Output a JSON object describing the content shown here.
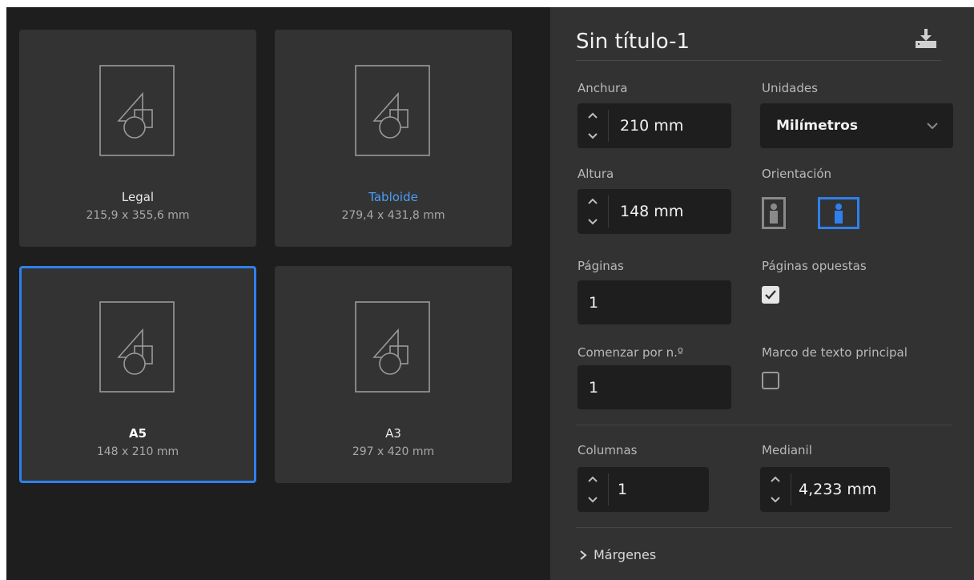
{
  "presets": [
    {
      "name": "Legal",
      "size": "215,9 x 355,6 mm",
      "selected": false,
      "highlight": false
    },
    {
      "name": "Tabloide",
      "size": "279,4 x 431,8 mm",
      "selected": false,
      "highlight": true
    },
    {
      "name": "A5",
      "size": "148 x 210 mm",
      "selected": true,
      "highlight": false
    },
    {
      "name": "A3",
      "size": "297 x 420 mm",
      "selected": false,
      "highlight": false
    }
  ],
  "panel": {
    "title": "Sin título-1",
    "width": {
      "label": "Anchura",
      "value": "210 mm"
    },
    "units": {
      "label": "Unidades",
      "value": "Milímetros"
    },
    "height": {
      "label": "Altura",
      "value": "148 mm"
    },
    "orientation": {
      "label": "Orientación",
      "selected": "landscape"
    },
    "pages": {
      "label": "Páginas",
      "value": "1"
    },
    "facing_pages": {
      "label": "Páginas opuestas",
      "checked": true
    },
    "start_at": {
      "label": "Comenzar por n.º",
      "value": "1"
    },
    "primary_text_frame": {
      "label": "Marco de texto principal",
      "checked": false
    },
    "columns": {
      "label": "Columnas",
      "value": "1"
    },
    "gutter": {
      "label": "Medianil",
      "value": "4,233 mm"
    },
    "margins": {
      "label": "Márgenes"
    }
  },
  "colors": {
    "accent": "#2f80ed",
    "highlight_text": "#4b9ef7",
    "panel_bg": "#323232",
    "grid_bg": "#1e1e1e"
  }
}
